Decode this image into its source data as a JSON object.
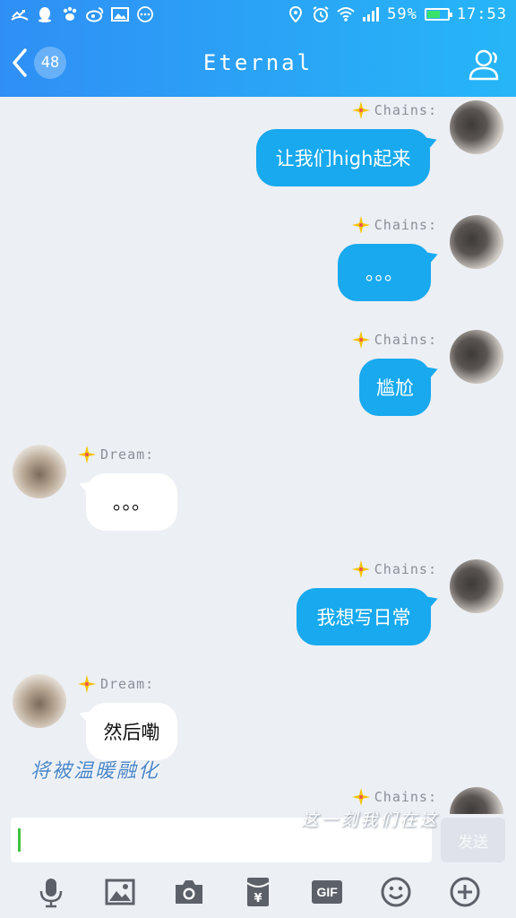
{
  "status_bar": {
    "battery_percent": "59%",
    "battery_level": 0.59,
    "time": "17:53",
    "left_icons": [
      "missed-call-icon",
      "qq-penguin-icon",
      "paw-icon",
      "weibo-icon",
      "gallery-icon",
      "dots-icon"
    ],
    "right_icons": [
      "location-icon",
      "alarm-icon",
      "wifi-icon",
      "signal-icon",
      "battery-icon"
    ]
  },
  "header": {
    "unread_count": "48",
    "title": "Eternal",
    "back_icon": "chevron-left-icon",
    "profile_icon": "profile-icon",
    "gradient_start": "#2f8ff5",
    "gradient_end": "#26b6f7"
  },
  "messages": [
    {
      "side": "out",
      "nickname": "Chains:",
      "text": "让我们high起来"
    },
    {
      "side": "out",
      "nickname": "Chains:",
      "text": "。。。"
    },
    {
      "side": "out",
      "nickname": "Chains:",
      "text": "尴尬"
    },
    {
      "side": "in",
      "nickname": "Dream:",
      "text": "。。。"
    },
    {
      "side": "out",
      "nickname": "Chains:",
      "text": "我想写日常"
    },
    {
      "side": "in",
      "nickname": "Dream:",
      "text": "然后嘞"
    },
    {
      "side": "out",
      "nickname": "Chains:",
      "text": ""
    }
  ],
  "overlays": {
    "text_left": "将被温暖融化",
    "text_right": "这一刻我们在这"
  },
  "composer": {
    "input_value": "",
    "send_label": "发送"
  },
  "toolbar": {
    "items": [
      "microphone-icon",
      "image-icon",
      "camera-icon",
      "red-packet-icon",
      "gif-icon",
      "emoji-icon",
      "plus-icon"
    ],
    "gif_label": "GIF"
  },
  "colors": {
    "outgoing_bubble": "#18a9ee",
    "incoming_bubble": "#ffffff",
    "background": "#eceff4",
    "badge_star": "#f5c400"
  }
}
